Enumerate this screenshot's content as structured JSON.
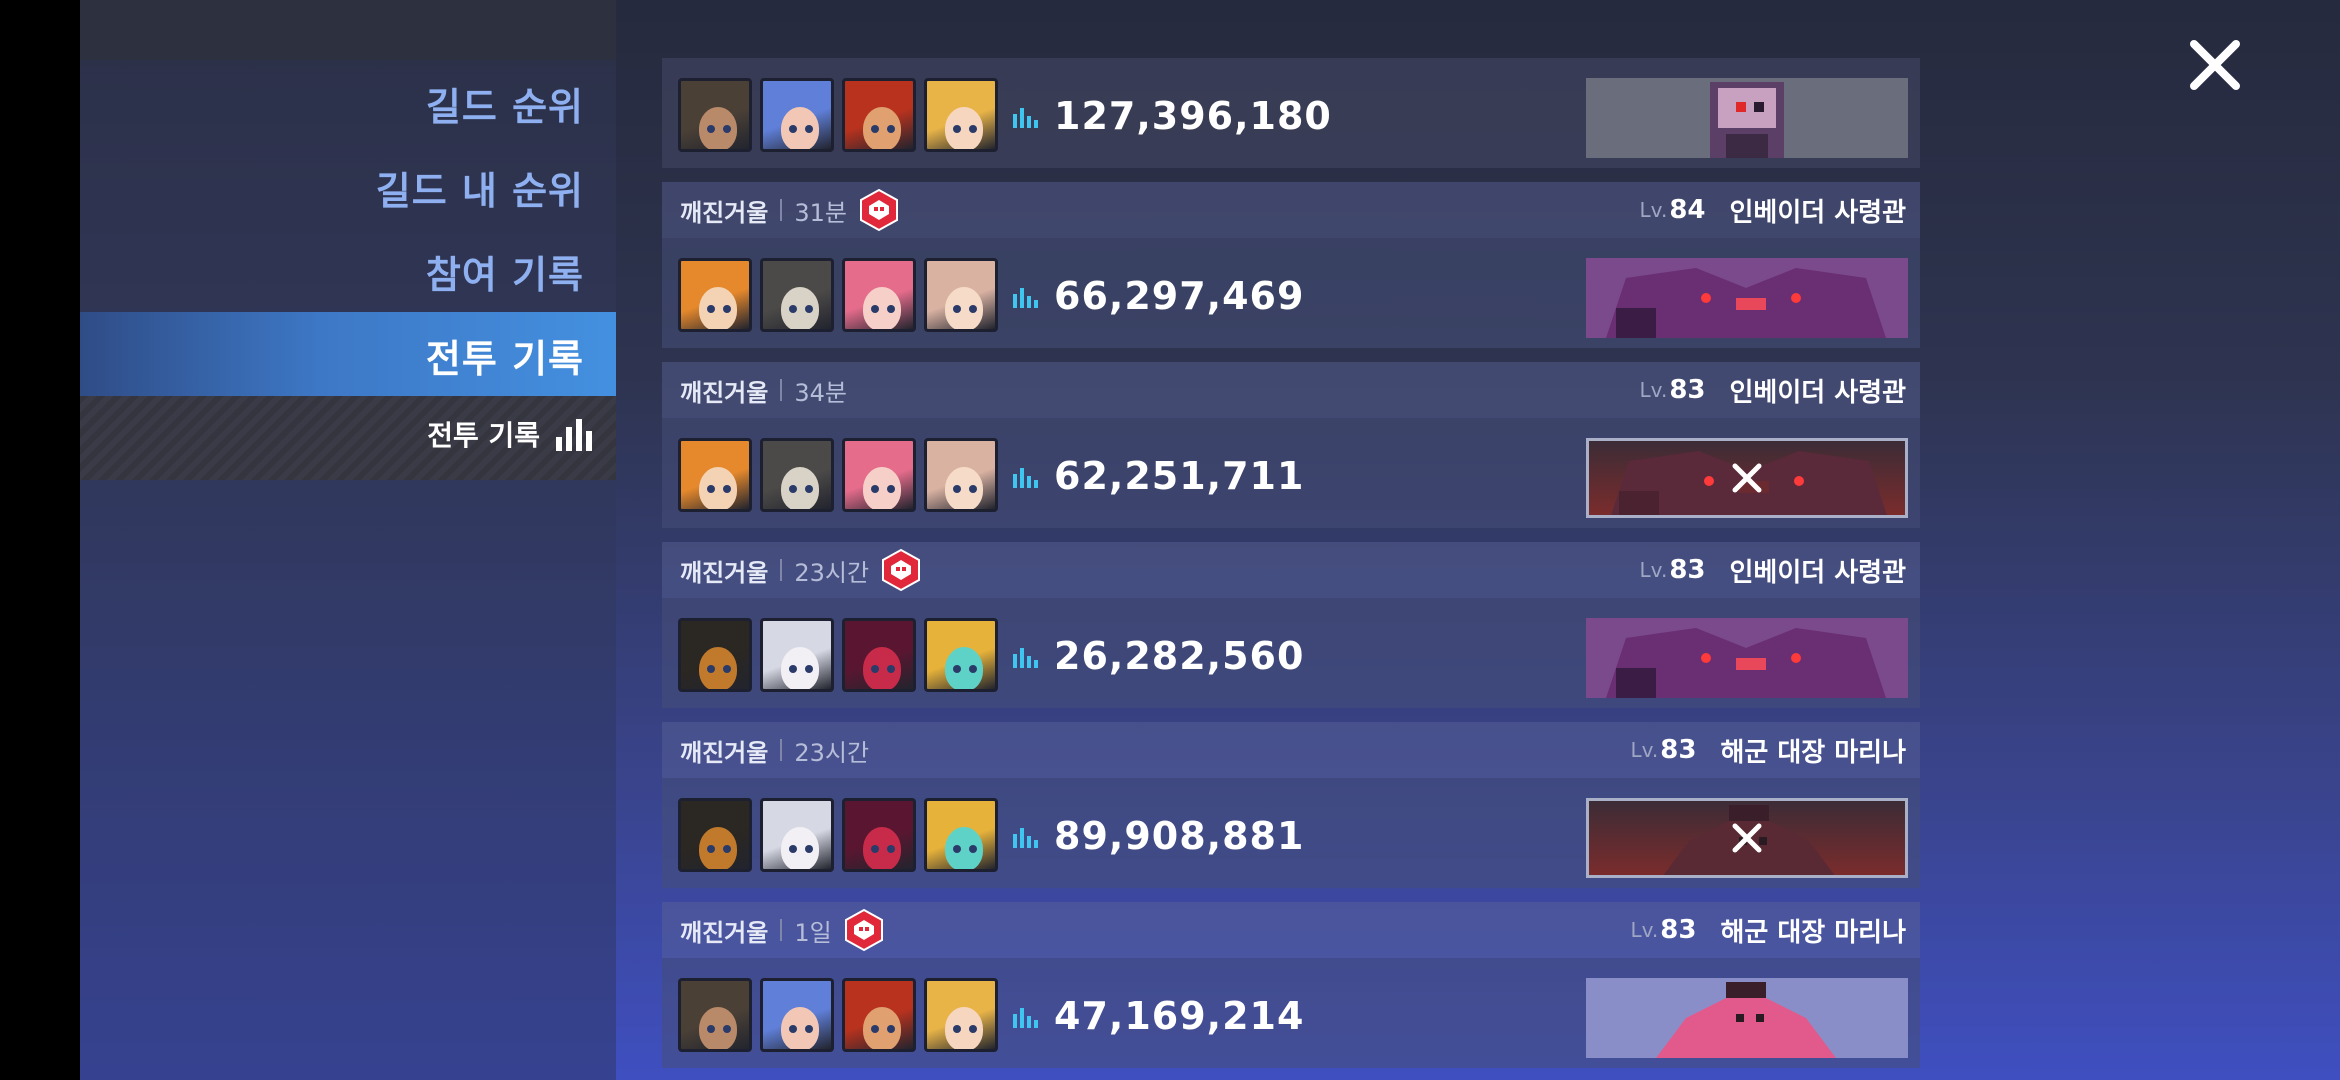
{
  "sidebar": {
    "items": [
      {
        "label": "길드 순위"
      },
      {
        "label": "길드 내 순위"
      },
      {
        "label": "참여 기록"
      },
      {
        "label": "전투 기록"
      }
    ],
    "sub_label": "전투 기록",
    "active_index": 3
  },
  "close_icon": "close-icon",
  "colors": {
    "accent": "#4490e0",
    "nav_text": "#8fb0f0",
    "badge_red": "#e0283a",
    "score_icon": "#3ec6f0"
  },
  "records": [
    {
      "guild": "",
      "ago": "",
      "has_badge": false,
      "lv_label": "",
      "level": "",
      "boss": "",
      "score": "127,396,180",
      "defeated": false,
      "party": [
        "hero-dark-hair",
        "hero-blue-hair",
        "hero-red-armor",
        "hero-blonde"
      ]
    },
    {
      "guild": "깨진거울",
      "ago": "31분",
      "has_badge": true,
      "lv_label": "Lv.",
      "level": "84",
      "boss": "인베이더 사령관",
      "score": "66,297,469",
      "defeated": false,
      "party": [
        "hero-orange-hair",
        "hero-grey-hair",
        "hero-pink-hair",
        "hero-light-hair"
      ]
    },
    {
      "guild": "깨진거울",
      "ago": "34분",
      "has_badge": false,
      "lv_label": "Lv.",
      "level": "83",
      "boss": "인베이더 사령관",
      "score": "62,251,711",
      "defeated": true,
      "party": [
        "hero-orange-hair",
        "hero-grey-hair",
        "hero-pink-hair",
        "hero-light-hair"
      ]
    },
    {
      "guild": "깨진거울",
      "ago": "23시간",
      "has_badge": true,
      "lv_label": "Lv.",
      "level": "83",
      "boss": "인베이더 사령관",
      "score": "26,282,560",
      "defeated": false,
      "party": [
        "hero-black-armor",
        "hero-white-hair",
        "hero-crimson-mask",
        "hero-blonde-visor"
      ]
    },
    {
      "guild": "깨진거울",
      "ago": "23시간",
      "has_badge": false,
      "lv_label": "Lv.",
      "level": "83",
      "boss": "해군 대장 마리나",
      "score": "89,908,881",
      "defeated": true,
      "party": [
        "hero-black-armor",
        "hero-white-hair",
        "hero-crimson-mask",
        "hero-blonde-visor"
      ]
    },
    {
      "guild": "깨진거울",
      "ago": "1일",
      "has_badge": true,
      "lv_label": "Lv.",
      "level": "83",
      "boss": "해군 대장 마리나",
      "score": "47,169,214",
      "defeated": false,
      "party": [
        "hero-dark-hair",
        "hero-blue-hair",
        "hero-red-armor",
        "hero-blonde"
      ]
    }
  ]
}
